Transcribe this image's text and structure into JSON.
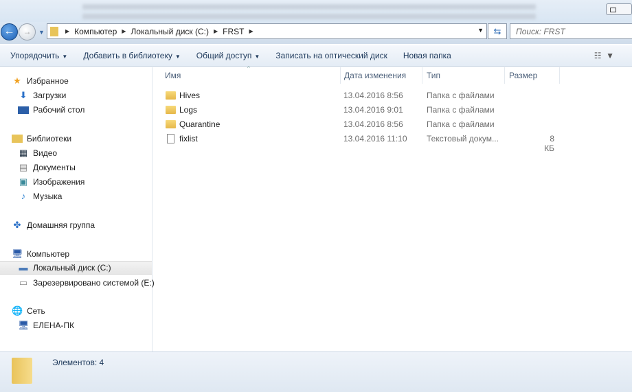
{
  "address": {
    "crumbs": [
      "Компьютер",
      "Локальный диск (C:)",
      "FRST"
    ],
    "search_placeholder": "Поиск: FRST"
  },
  "toolbar": {
    "organize": "Упорядочить",
    "add_library": "Добавить в библиотеку",
    "share": "Общий доступ",
    "burn": "Записать на оптический диск",
    "new_folder": "Новая папка"
  },
  "sidebar": {
    "favorites": "Избранное",
    "downloads": "Загрузки",
    "desktop": "Рабочий стол",
    "libraries": "Библиотеки",
    "video": "Видео",
    "documents": "Документы",
    "images": "Изображения",
    "music": "Музыка",
    "homegroup": "Домашняя группа",
    "computer": "Компьютер",
    "local_disk": "Локальный диск (C:)",
    "reserved": "Зарезервировано системой (E:)",
    "network": "Сеть",
    "pc": "ЕЛЕНА-ПК"
  },
  "columns": {
    "name": "Имя",
    "date": "Дата изменения",
    "type": "Тип",
    "size": "Размер"
  },
  "files": [
    {
      "name": "Hives",
      "date": "13.04.2016 8:56",
      "type": "Папка с файлами",
      "size": ""
    },
    {
      "name": "Logs",
      "date": "13.04.2016 9:01",
      "type": "Папка с файлами",
      "size": ""
    },
    {
      "name": "Quarantine",
      "date": "13.04.2016 8:56",
      "type": "Папка с файлами",
      "size": ""
    },
    {
      "name": "fixlist",
      "date": "13.04.2016 11:10",
      "type": "Текстовый докум...",
      "size": "8 КБ"
    }
  ],
  "status": {
    "count": "Элементов: 4"
  }
}
